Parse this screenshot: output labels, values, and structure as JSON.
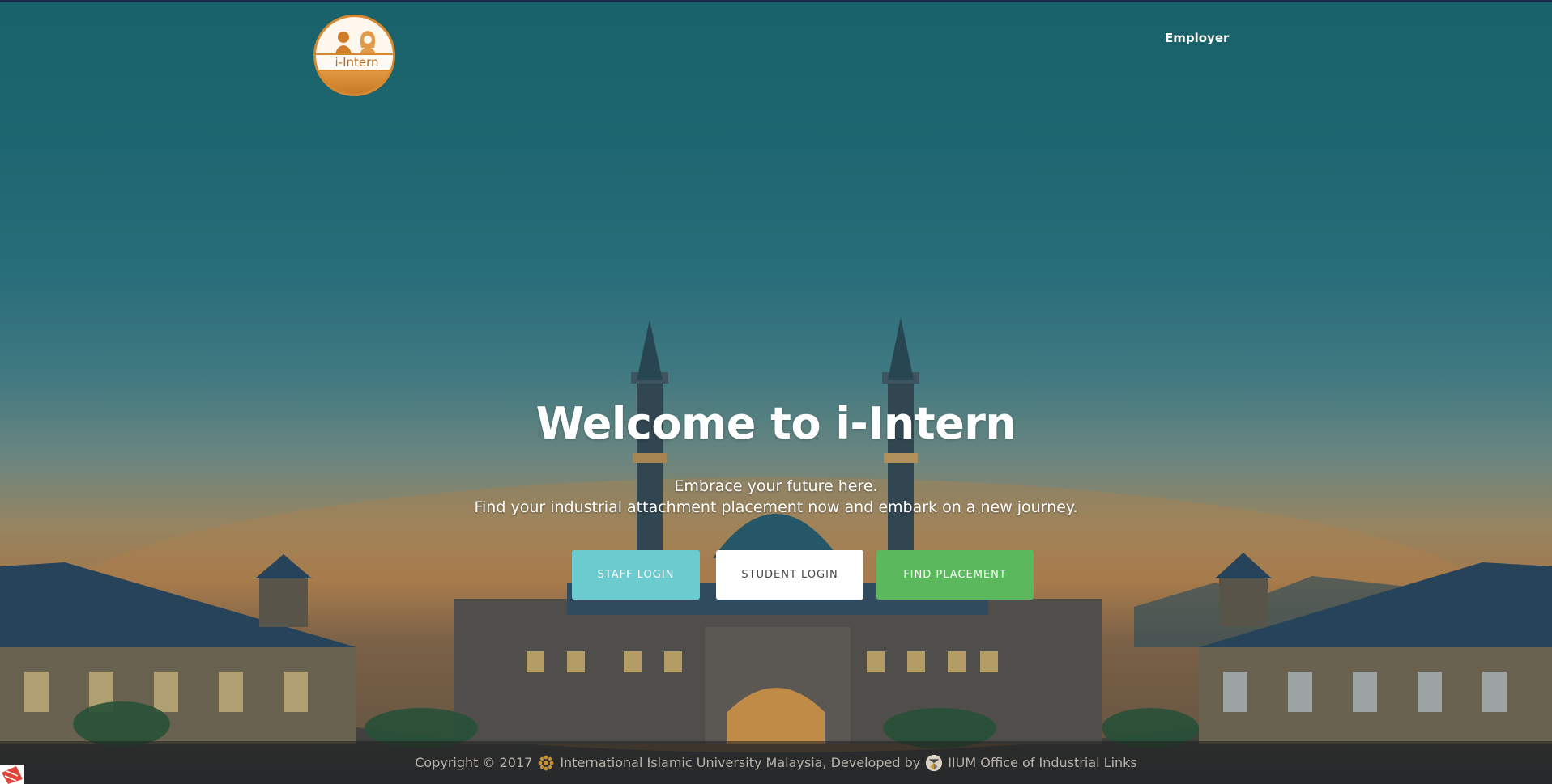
{
  "header": {
    "logo_text": "i-Intern",
    "nav_employer": "Employer"
  },
  "hero": {
    "title": "Welcome to i-Intern",
    "subtitle_line1": "Embrace your future here.",
    "subtitle_line2": "Find your industrial attachment placement now and embark on a new journey."
  },
  "buttons": {
    "staff_login": "STAFF LOGIN",
    "student_login": "STUDENT LOGIN",
    "find_placement": "FIND PLACEMENT"
  },
  "footer": {
    "copyright": "Copyright © 2017",
    "university": "International Islamic University Malaysia, Developed by",
    "office": "IIUM Office of Industrial Links"
  },
  "colors": {
    "staff_button": "#6ccbcf",
    "student_button": "#ffffff",
    "find_button": "#5cb85c",
    "logo_accent": "#d8892f"
  },
  "icons": {
    "logo": "i-intern-logo",
    "footer_university": "iium-emblem-icon",
    "footer_office": "oil-logo-icon",
    "corner": "app-corner-icon"
  }
}
